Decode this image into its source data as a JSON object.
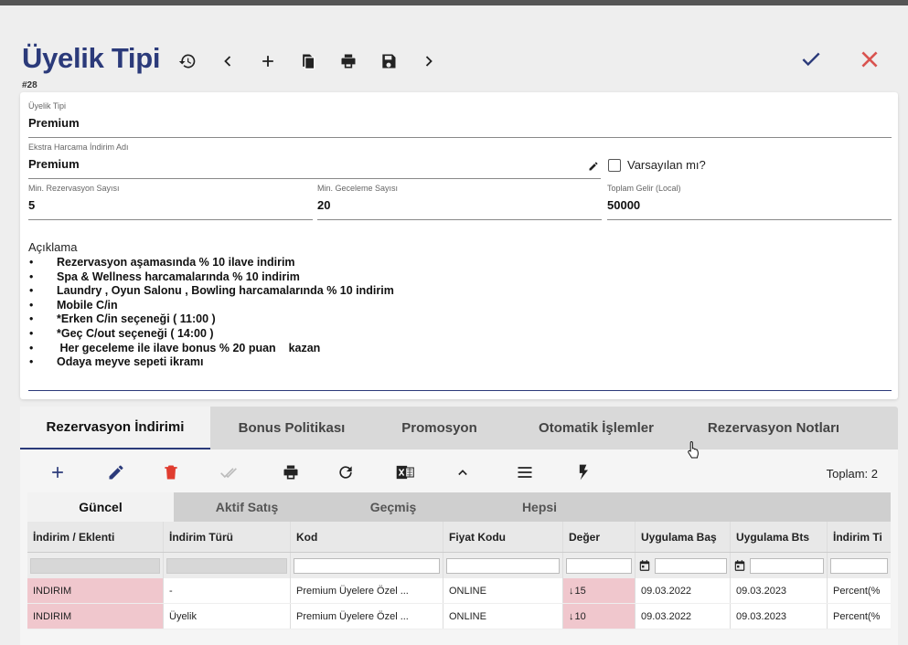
{
  "window_title": "Üyelik Tipi",
  "header": {
    "title": "Üyelik Tipi",
    "record_id": "#28"
  },
  "form": {
    "membership_type": {
      "label": "Üyelik Tipi",
      "value": "Premium"
    },
    "extra_discount_name": {
      "label": "Ekstra Harcama İndirim Adı",
      "value": "Premium"
    },
    "default_checkbox": {
      "label": "Varsayılan mı?",
      "checked": false
    },
    "min_reservation": {
      "label": "Min. Rezervasyon Sayısı",
      "value": "5"
    },
    "min_nights": {
      "label": "Min. Geceleme Sayısı",
      "value": "20"
    },
    "total_income": {
      "label": "Toplam Gelir (Local)",
      "value": "50000"
    },
    "description": {
      "label": "Açıklama",
      "bullet": "•",
      "lines": [
        "Rezervasyon aşamasında % 10 ilave indirim",
        "Spa & Wellness harcamalarında % 10 indirim",
        "Laundry , Oyun Salonu , Bowling harcamalarında % 10 indirim",
        "Mobile C/in",
        "*Erken C/in seçeneği ( 11:00 )",
        "*Geç C/out seçeneği ( 14:00 )",
        " Her geceleme ile ilave bonus % 20 puan    kazan",
        "Odaya meyve sepeti ikramı"
      ]
    }
  },
  "tabs": [
    "Rezervasyon İndirimi",
    "Bonus Politikası",
    "Promosyon",
    "Otomatik İşlemler",
    "Rezervasyon Notları"
  ],
  "toolbar": {
    "total_label": "Toplam: 2"
  },
  "subtabs": [
    "Güncel",
    "Aktif Satış",
    "Geçmiş",
    "Hepsi"
  ],
  "grid": {
    "columns": [
      "İndirim / Eklenti",
      "İndirim Türü",
      "Kod",
      "Fiyat Kodu",
      "Değer",
      "Uygulama Baş",
      "Uygulama Bts",
      "İndirim Ti"
    ],
    "rows": [
      {
        "type": "INDIRIM",
        "discount_type": "-",
        "code": "Premium Üyelere Özel ...",
        "price_code": "ONLINE",
        "value": "15",
        "start": "09.03.2022",
        "end": "09.03.2023",
        "kind": "Percent(%"
      },
      {
        "type": "INDIRIM",
        "discount_type": "Üyelik",
        "code": "Premium Üyelere Özel ...",
        "price_code": "ONLINE",
        "value": "10",
        "start": "09.03.2022",
        "end": "09.03.2023",
        "kind": "Percent(%"
      }
    ]
  },
  "colors": {
    "title_blue": "#2b3a7a",
    "cancel_red": "#d9534f",
    "row_pink": "#f0c7cd"
  },
  "icons": [
    "history-icon",
    "prev-icon",
    "add-icon",
    "copy-icon",
    "print-icon",
    "save-icon",
    "next-icon",
    "check-icon",
    "close-icon",
    "pencil-icon",
    "trash-icon",
    "double-check-icon",
    "refresh-icon",
    "excel-icon",
    "chevron-up-icon",
    "menu-icon",
    "bolt-icon",
    "calendar-icon"
  ]
}
